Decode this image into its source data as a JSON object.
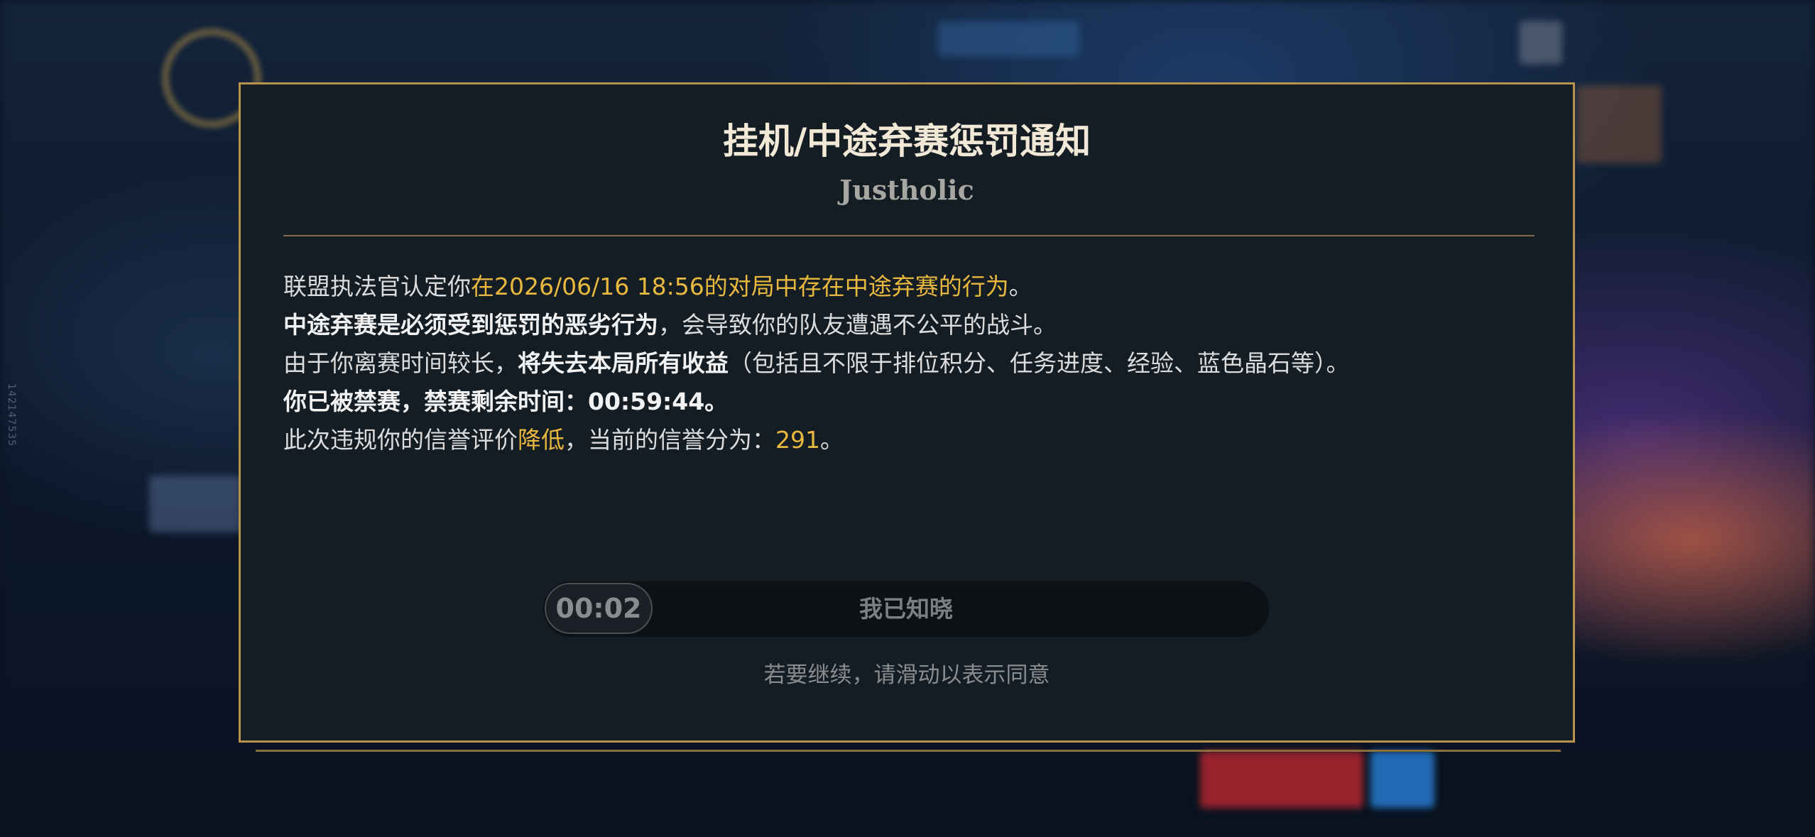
{
  "background": {
    "side_id": "142147535"
  },
  "dialog": {
    "title": "挂机/中途弃赛惩罚通知",
    "player_name": "Justholic",
    "lines": [
      {
        "prefix": "联盟执法官认定你",
        "highlight": "在2026/06/16 18:56的对局中存在中途弃赛的行为",
        "suffix": "。"
      },
      {
        "bold": "中途弃赛是必须受到惩罚的恶劣行为",
        "rest": "，会导致你的队友遭遇不公平的战斗。"
      },
      {
        "prefix": "由于你离赛时间较长，",
        "bold": "将失去本局所有收益",
        "suffix": "（包括且不限于排位积分、任务进度、经验、蓝色晶石等）。"
      },
      {
        "bold": "你已被禁赛，禁赛剩余时间：00:59:44。"
      },
      {
        "prefix": "此次违规你的信誉评价",
        "highlight": "降低",
        "middle": "，当前的信誉分为：",
        "score": "291",
        "suffix": "。"
      }
    ],
    "slider": {
      "timer": "00:02",
      "label": "我已知晓"
    },
    "hint": "若要继续，请滑动以表示同意"
  },
  "colors": {
    "border": "#b7934d",
    "highlight": "#e8b93e",
    "panel": "#141c24"
  }
}
